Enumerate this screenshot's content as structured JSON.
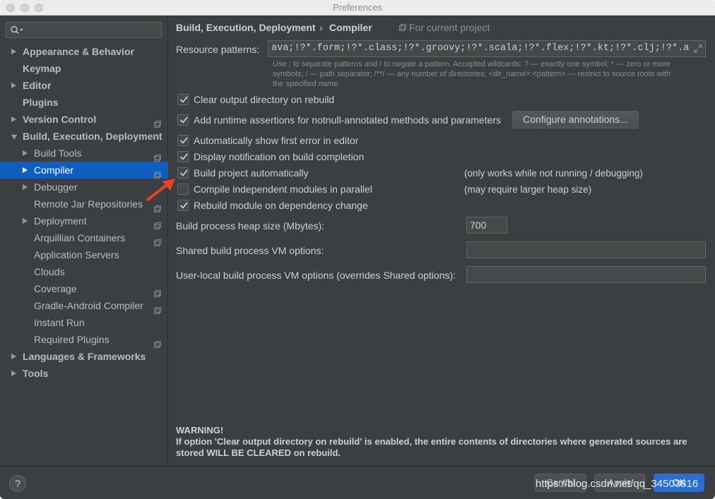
{
  "window": {
    "title": "Preferences"
  },
  "search": {
    "placeholder": ""
  },
  "sidebar": {
    "items": [
      {
        "label": "Appearance & Behavior",
        "bold": true,
        "expander": "collapsed",
        "project_icon": false
      },
      {
        "label": "Keymap",
        "bold": true,
        "expander": "none",
        "project_icon": false
      },
      {
        "label": "Editor",
        "bold": true,
        "expander": "collapsed",
        "project_icon": false
      },
      {
        "label": "Plugins",
        "bold": true,
        "expander": "none",
        "project_icon": false
      },
      {
        "label": "Version Control",
        "bold": true,
        "expander": "collapsed",
        "project_icon": true
      },
      {
        "label": "Build, Execution, Deployment",
        "bold": true,
        "expander": "expanded",
        "project_icon": false
      },
      {
        "label": "Build Tools",
        "bold": false,
        "expander": "collapsed",
        "project_icon": true
      },
      {
        "label": "Compiler",
        "bold": false,
        "expander": "collapsed",
        "project_icon": true,
        "selected": true
      },
      {
        "label": "Debugger",
        "bold": false,
        "expander": "collapsed",
        "project_icon": false
      },
      {
        "label": "Remote Jar Repositories",
        "bold": false,
        "expander": "none",
        "project_icon": true
      },
      {
        "label": "Deployment",
        "bold": false,
        "expander": "collapsed",
        "project_icon": true
      },
      {
        "label": "Arquillian Containers",
        "bold": false,
        "expander": "none",
        "project_icon": true
      },
      {
        "label": "Application Servers",
        "bold": false,
        "expander": "none",
        "project_icon": false
      },
      {
        "label": "Clouds",
        "bold": false,
        "expander": "none",
        "project_icon": false
      },
      {
        "label": "Coverage",
        "bold": false,
        "expander": "none",
        "project_icon": true
      },
      {
        "label": "Gradle-Android Compiler",
        "bold": false,
        "expander": "none",
        "project_icon": true
      },
      {
        "label": "Instant Run",
        "bold": false,
        "expander": "none",
        "project_icon": false
      },
      {
        "label": "Required Plugins",
        "bold": false,
        "expander": "none",
        "project_icon": true
      },
      {
        "label": "Languages & Frameworks",
        "bold": true,
        "expander": "collapsed",
        "project_icon": false
      },
      {
        "label": "Tools",
        "bold": true,
        "expander": "collapsed",
        "project_icon": false
      }
    ]
  },
  "breadcrumb": {
    "parent": "Build, Execution, Deployment",
    "separator": "›",
    "current": "Compiler",
    "scope": "For current project"
  },
  "resource_patterns": {
    "label": "Resource patterns:",
    "value": "ava;!?*.form;!?*.class;!?*.groovy;!?*.scala;!?*.flex;!?*.kt;!?*.clj;!?*.aj",
    "hint_line1": "Use ; to separate patterns and ! to negate a pattern. Accepted wildcards: ? — exactly one symbol; * — zero or more",
    "hint_line2": "symbols; / — path separator; /**/ — any number of directories; <dir_name>:<pattern> — restrict to source roots with",
    "hint_line3": "the specified name"
  },
  "options": [
    {
      "label": "Clear output directory on rebuild",
      "checked": true,
      "note": ""
    },
    {
      "label": "Add runtime assertions for notnull-annotated methods and parameters",
      "checked": true,
      "note": ""
    },
    {
      "label": "Automatically show first error in editor",
      "checked": true,
      "note": ""
    },
    {
      "label": "Display notification on build completion",
      "checked": true,
      "note": ""
    },
    {
      "label": "Build project automatically",
      "checked": true,
      "note": "(only works while not running / debugging)"
    },
    {
      "label": "Compile independent modules in parallel",
      "checked": false,
      "note": "(may require larger heap size)"
    },
    {
      "label": "Rebuild module on dependency change",
      "checked": true,
      "note": ""
    }
  ],
  "configure_annotations_label": "Configure annotations...",
  "heap": {
    "label": "Build process heap size (Mbytes):",
    "value": "700"
  },
  "shared_vm": {
    "label": "Shared build process VM options:",
    "value": ""
  },
  "user_vm": {
    "label": "User-local build process VM options (overrides Shared options):",
    "value": ""
  },
  "warning": {
    "title": "WARNING!",
    "body": "If option 'Clear output directory on rebuild' is enabled, the entire contents of directories where generated sources are stored WILL BE CLEARED on rebuild."
  },
  "footer": {
    "help": "?",
    "cancel": "Cancel",
    "apply": "Apply",
    "ok": "OK",
    "watermark": "https://blog.csdn.net/qq_34503816"
  },
  "colors": {
    "selection": "#0d5ebf",
    "annotation_arrow": "#e8402a",
    "primary_button": "#2a6fcf"
  }
}
